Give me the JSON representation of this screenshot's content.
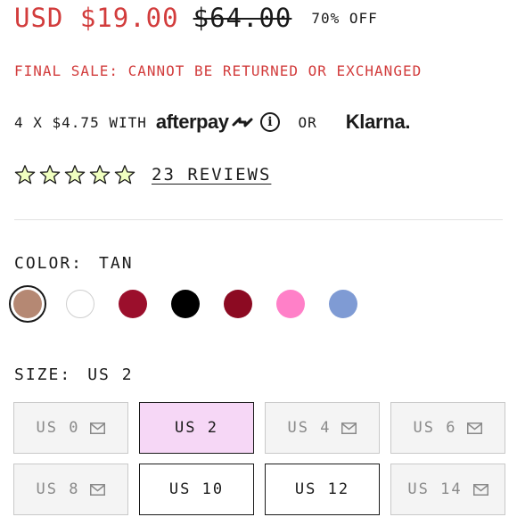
{
  "pricing": {
    "current_price": "USD $19.00",
    "original_price": "$64.00",
    "discount": "70% OFF"
  },
  "notice": {
    "final_sale": "FINAL SALE: CANNOT BE RETURNED OR EXCHANGED"
  },
  "payment": {
    "installments": "4 X $4.75 WITH",
    "afterpay_label": "afterpay",
    "info_icon": "i",
    "or_label": "OR",
    "klarna_label": "Klarna."
  },
  "reviews": {
    "rating": 0,
    "max_rating": 5,
    "star_fill_color": "#f0ffc0",
    "star_outline_color": "#1a1a1a",
    "link_text": "23 REVIEWS"
  },
  "color": {
    "label": "COLOR:",
    "selected": "TAN",
    "swatches": [
      {
        "hex": "#b58873",
        "selected": true
      },
      {
        "hex": "#ffffff",
        "selected": false
      },
      {
        "hex": "#9b0f2c",
        "selected": false
      },
      {
        "hex": "#000000",
        "selected": false
      },
      {
        "hex": "#8c0a22",
        "selected": false
      },
      {
        "hex": "#ff80c8",
        "selected": false
      },
      {
        "hex": "#7f9bd4",
        "selected": false
      }
    ]
  },
  "size": {
    "label": "SIZE:",
    "selected": "US 2",
    "options": [
      {
        "label": "US 0",
        "state": "unavailable"
      },
      {
        "label": "US 2",
        "state": "selected"
      },
      {
        "label": "US 4",
        "state": "unavailable"
      },
      {
        "label": "US 6",
        "state": "unavailable"
      },
      {
        "label": "US 8",
        "state": "unavailable"
      },
      {
        "label": "US 10",
        "state": "available"
      },
      {
        "label": "US 12",
        "state": "available"
      },
      {
        "label": "US 14",
        "state": "unavailable"
      }
    ]
  },
  "colors": {
    "sale_red": "#d23c3c",
    "selected_size_bg": "#f6d7f6",
    "unavailable_bg": "#f4f4f4"
  }
}
